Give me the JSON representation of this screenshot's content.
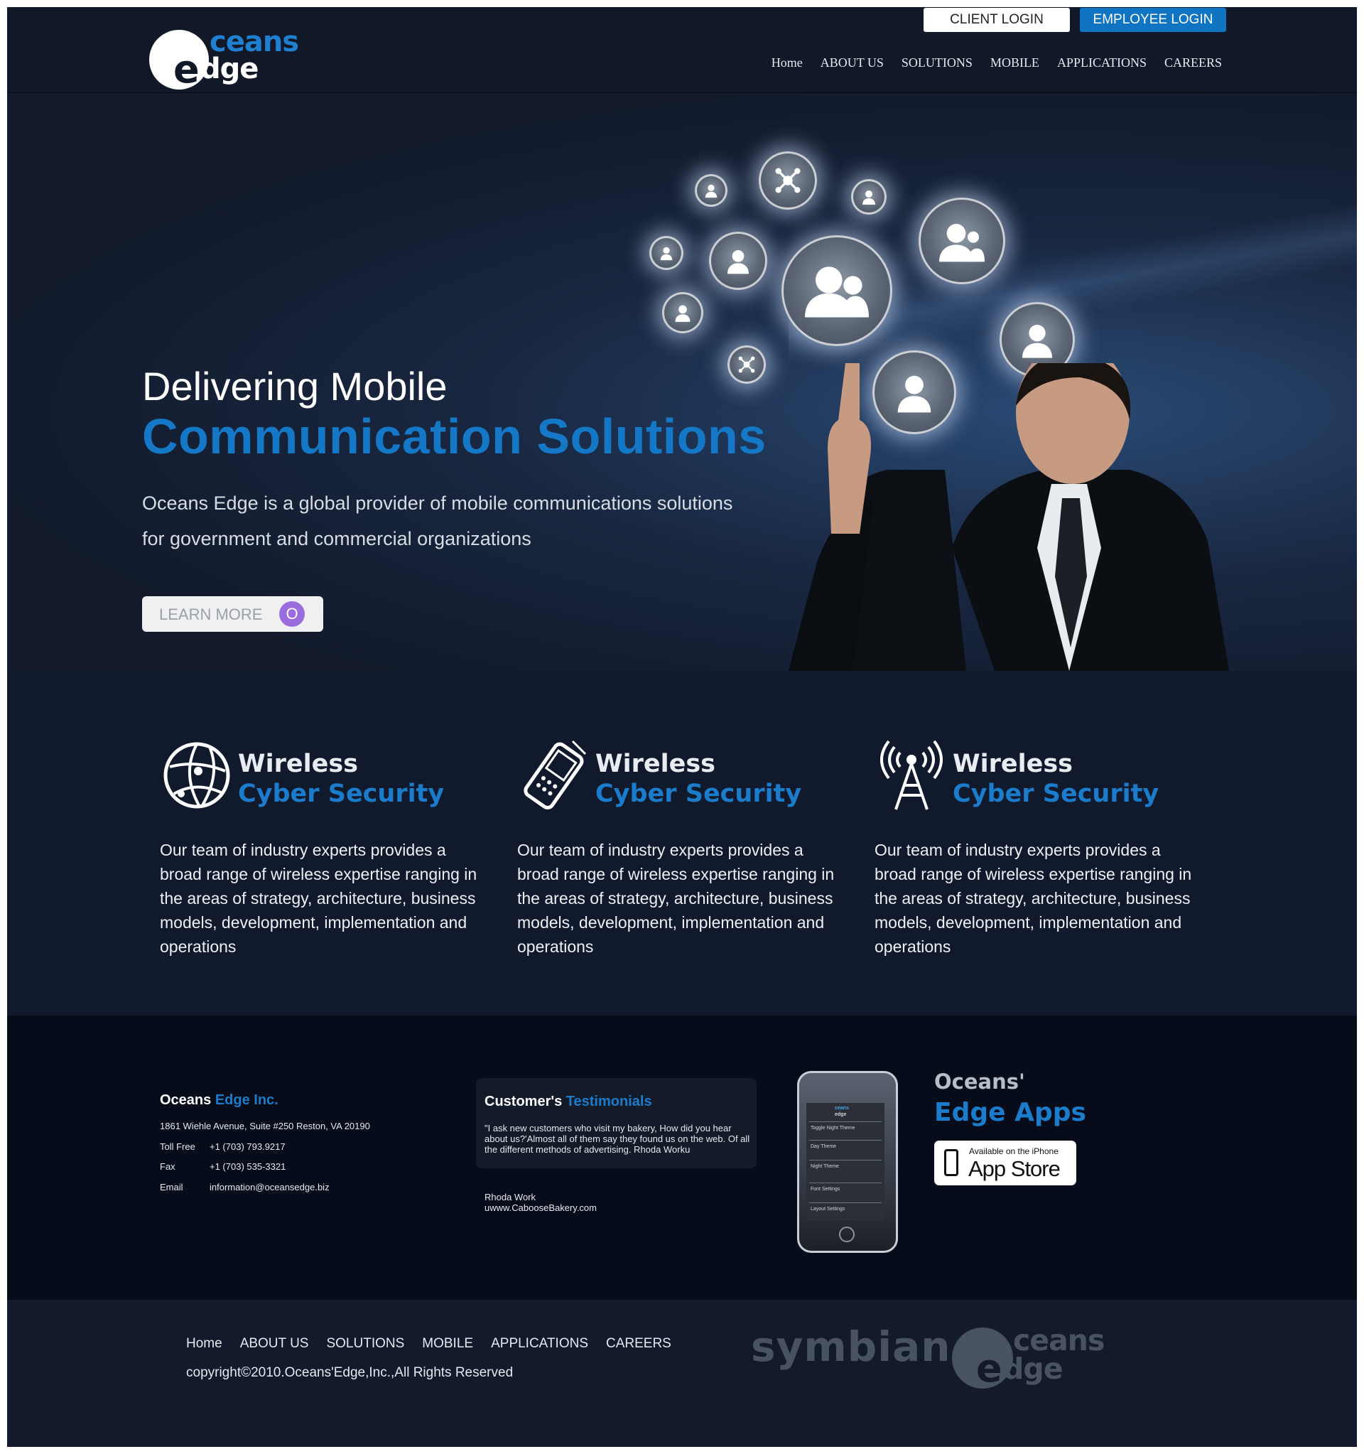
{
  "header": {
    "logo": {
      "top": "ceans",
      "initial": "e",
      "bottom": "dge"
    },
    "client_login": "CLIENT LOGIN",
    "employee_login": "EMPLOYEE LOGIN",
    "nav": [
      "Home",
      "ABOUT US",
      "SOLUTIONS",
      "MOBILE",
      "APPLICATIONS",
      "CAREERS"
    ]
  },
  "hero": {
    "title_line1": "Delivering Mobile",
    "title_line2": "Communication Solutions",
    "desc_line1": "Oceans Edge is a global provider of mobile communications solutions",
    "desc_line2": "for government and commercial organizations",
    "button_label": "LEARN MORE",
    "button_icon": "O"
  },
  "features": [
    {
      "icon": "globe-icon",
      "heading1": "Wireless",
      "heading2": "Cyber Security",
      "body": "Our team of industry experts provides a broad range of wireless expertise ranging in the areas of strategy, architecture, business models, development, implementation and operations"
    },
    {
      "icon": "mobile-phone-icon",
      "heading1": "Wireless",
      "heading2": "Cyber Security",
      "body": "Our team of industry experts provides a broad range of wireless expertise ranging in the areas of strategy, architecture, business models, development, implementation and operations"
    },
    {
      "icon": "antenna-tower-icon",
      "heading1": "Wireless",
      "heading2": "Cyber Security",
      "body": "Our team of industry experts provides a broad range of wireless expertise ranging in the areas of strategy, architecture, business models, development, implementation and operations"
    }
  ],
  "contact": {
    "company_a": "Oceans",
    "company_b": "Edge Inc.",
    "address": "1861 Wiehle Avenue, Suite #250 Reston, VA 20190",
    "rows": [
      {
        "label": "Toll Free",
        "value": "+1 (703) 793.9217"
      },
      {
        "label": "Fax",
        "value": "+1 (703) 535-3321"
      },
      {
        "label": "Email",
        "value": "information@oceansedge.biz"
      }
    ]
  },
  "testimonial": {
    "title_a": "Customer's",
    "title_b": "Testimonials",
    "quote": "\"I ask new customers who visit my bakery, How did you hear about us?'Almost all of them say they found us on the web. Of all the different methods of advertising. Rhoda Worku",
    "sig_name": "Rhoda Work",
    "sig_site": "uwww.CabooseBakery.com"
  },
  "phone_screen": {
    "logo_top": "ceans",
    "logo_bottom": "edge",
    "rows": [
      "Toggle Night Theme",
      "Day Theme",
      "Night Theme",
      "Font Settings",
      "Layout Settings"
    ]
  },
  "apps": {
    "line1": "Oceans'",
    "line2": "Edge Apps",
    "store_small": "Available on the iPhone",
    "store_big": "App Store"
  },
  "footer": {
    "nav": [
      "Home",
      "ABOUT US",
      "SOLUTIONS",
      "MOBILE",
      "APPLICATIONS",
      "CAREERS"
    ],
    "copyright": "copyright©2010.Oceans'Edge,Inc.,All Rights Reserved",
    "partner": "symbian",
    "logo": {
      "top": "ceans",
      "initial": "e",
      "bottom": "dge"
    }
  },
  "colors": {
    "accent": "#1578c7",
    "background": "#121a2b",
    "dark_band": "#060c19"
  }
}
